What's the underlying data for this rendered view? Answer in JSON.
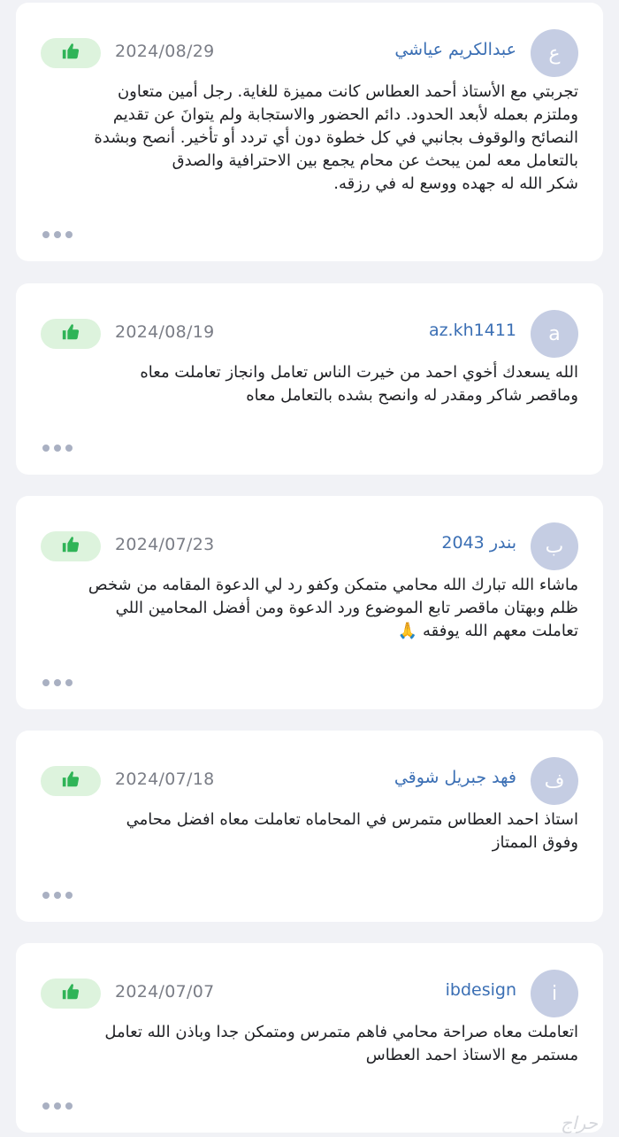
{
  "reviews": [
    {
      "avatar_letter": "ع",
      "name": "عبدالكريم عياشي",
      "date": "2024/08/29",
      "text": "تجربتي مع الأستاذ أحمد العطاس كانت مميزة للغاية. رجل أمين  متعاون\nوملتزم بعمله لأبعد الحدود. دائم الحضور والاستجابة  ولم يتوانَ عن تقديم\nالنصائح والوقوف بجانبي في كل خطوة  دون أي تردد أو تأخير. أنصح وبشدة\nبالتعامل معه لمن يبحث عن محام  يجمع بين الاحترافية والصدق\nشكر الله له جهده ووسع له في رزقه."
    },
    {
      "avatar_letter": "a",
      "name": "az.kh1411",
      "date": "2024/08/19",
      "text": "الله يسعدك أخوي احمد من خيرت الناس تعامل وانجاز تعاملت معاه\nوماقصر شاكر ومقدر له وانصح بشده بالتعامل معاه"
    },
    {
      "avatar_letter": "ب",
      "name": "بندر 2043",
      "date": "2024/07/23",
      "text": "ماشاء الله تبارك الله محامي متمكن وكفو رد لي الدعوة المقامه من شخص\nظلم وبهتان ماقصر تابع الموضوع ورد الدعوة ومن أفضل المحامين اللي\nتعاملت معهم الله يوفقه 🙏"
    },
    {
      "avatar_letter": "ف",
      "name": "فهد جبريل شوقي",
      "date": "2024/07/18",
      "text": "استاذ احمد العطاس متمرس في المحاماه  تعاملت معاه افضل محامي\nوفوق الممتاز"
    },
    {
      "avatar_letter": "i",
      "name": "ibdesign",
      "date": "2024/07/07",
      "text": "اتعاملت معاه صراحة محامي فاهم متمرس ومتمكن جدا وباذن الله تعامل\nمستمر مع الاستاذ احمد العطاس"
    }
  ],
  "colors": {
    "accent": "#3b6fb4",
    "like_bg": "#ddf3dd",
    "like_icon": "#2fb457",
    "avatar_bg": "#c5cde3"
  },
  "icons": {
    "like": "thumbs-up-icon",
    "more": "more-dots-icon"
  },
  "watermark": "حراج"
}
